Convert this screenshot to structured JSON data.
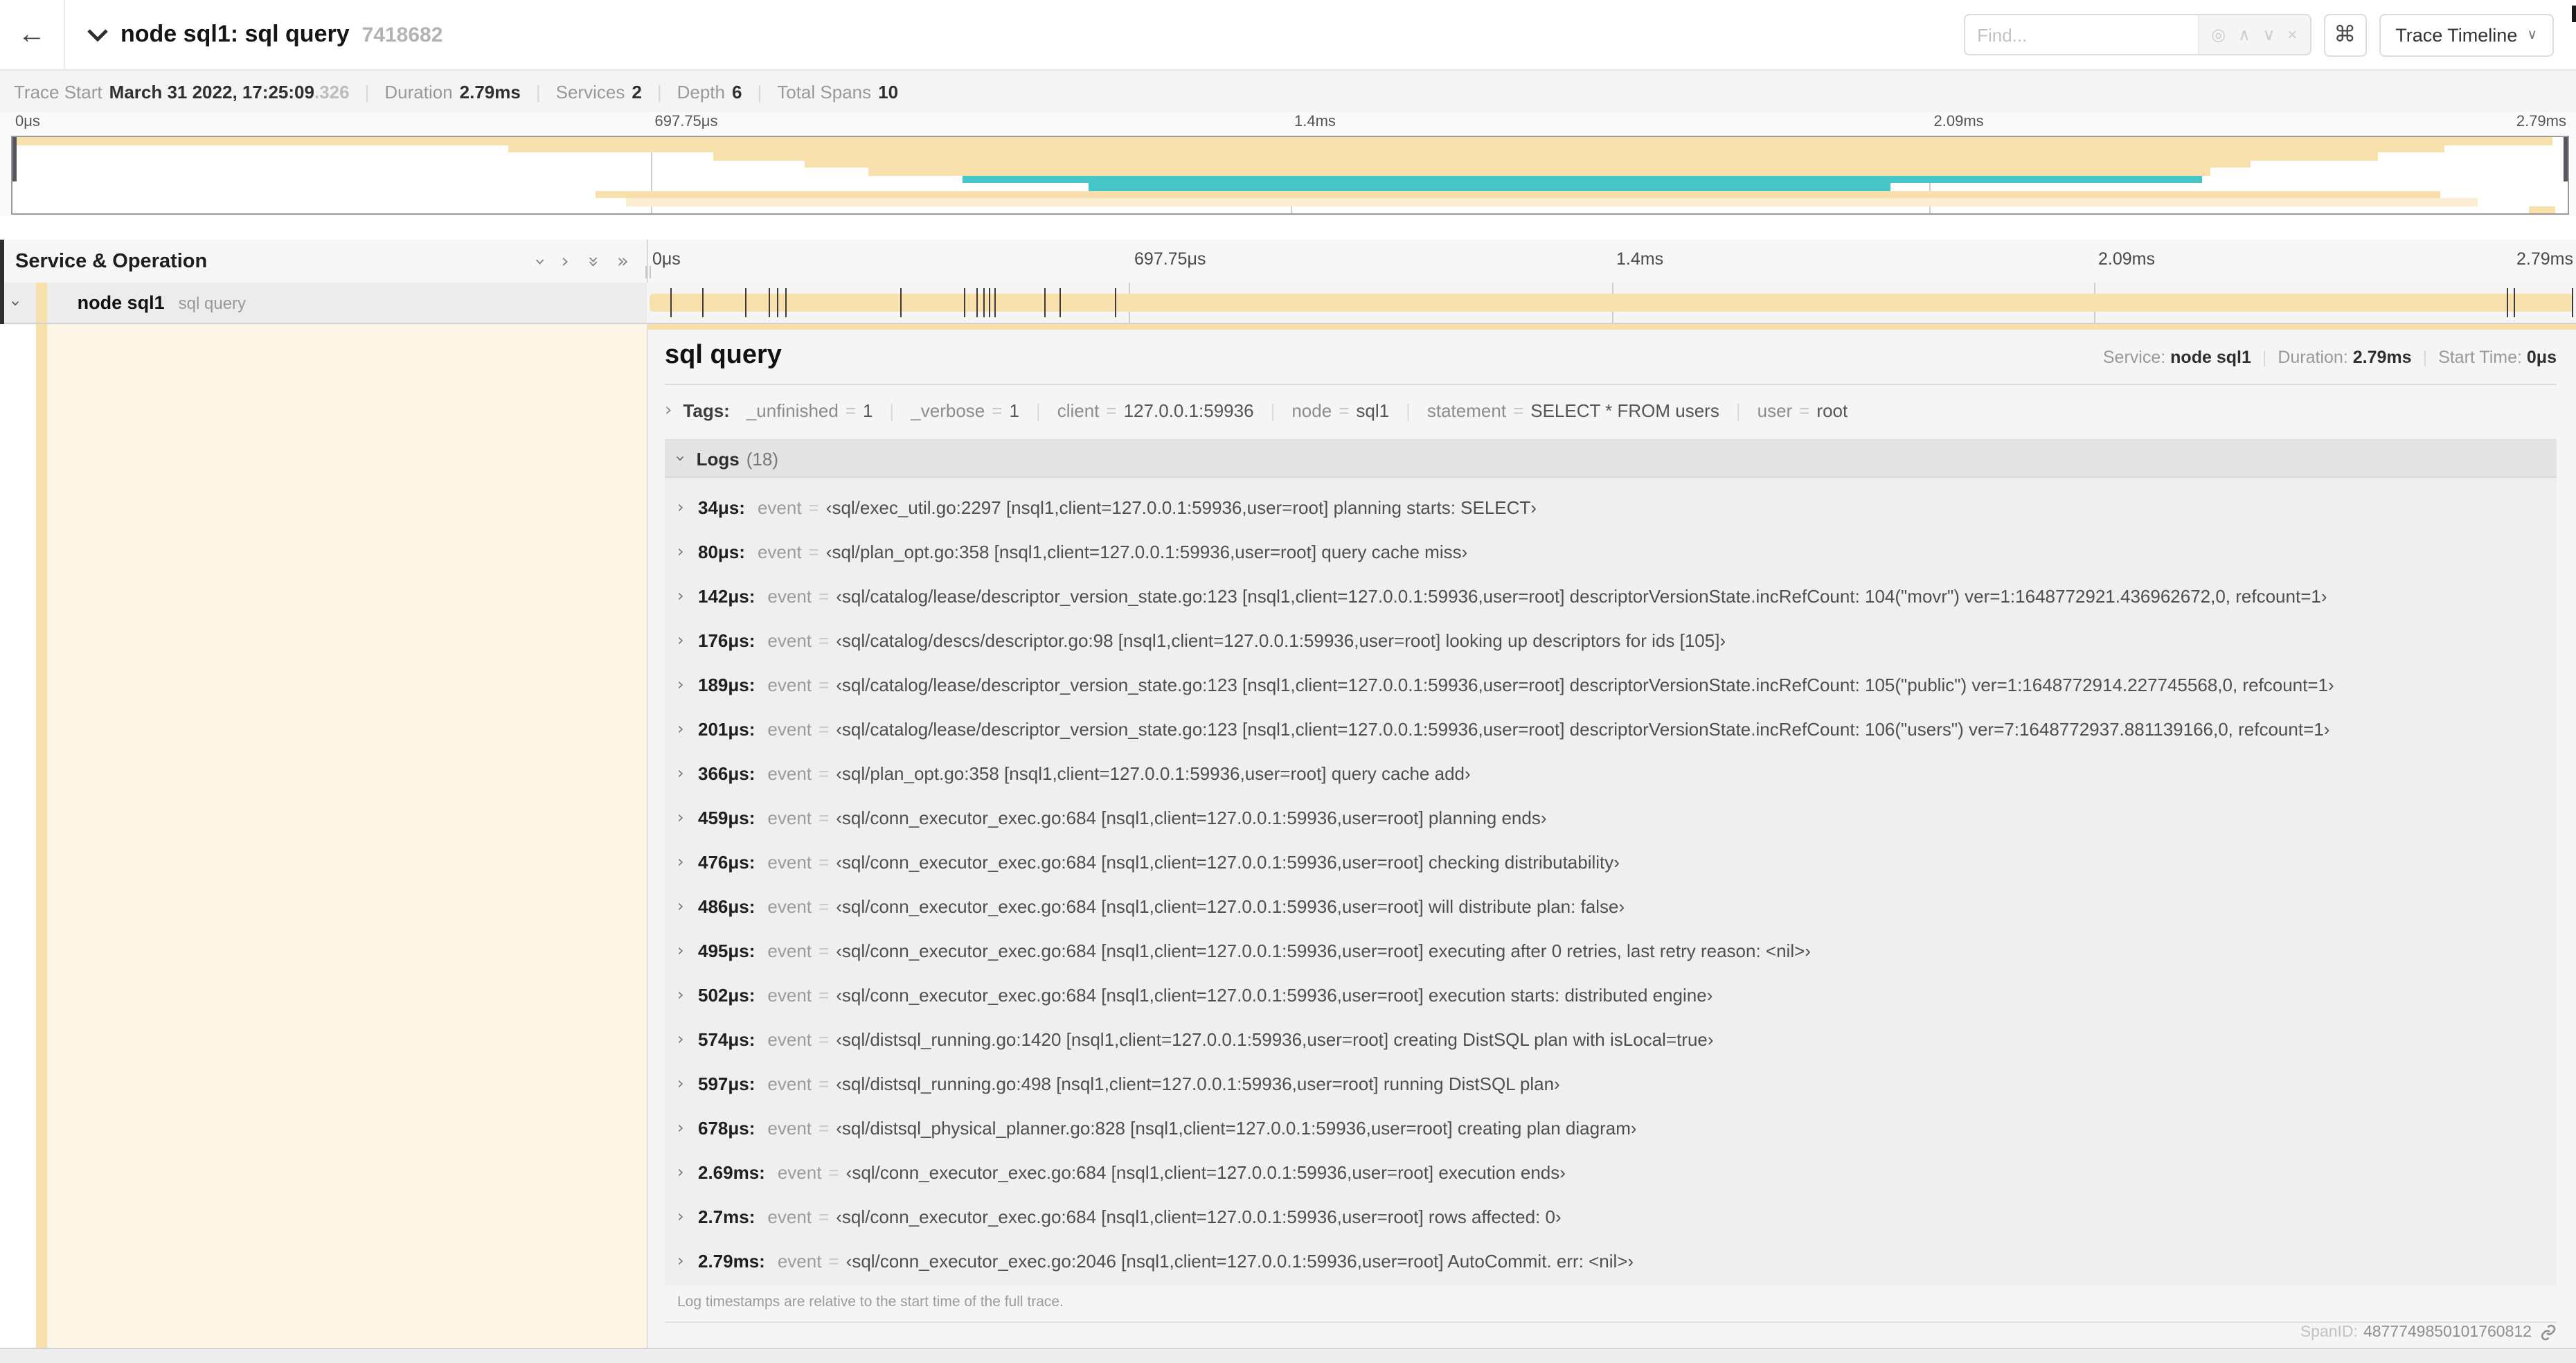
{
  "header": {
    "back_icon": "←",
    "title": "node sql1: sql query",
    "trace_id": "7418682",
    "find_placeholder": "Find...",
    "find_icons": [
      "◎",
      "∧",
      "∨",
      "×"
    ],
    "shortcut_button": "⌘",
    "view_selector": "Trace Timeline"
  },
  "trace_info": {
    "items": [
      {
        "label": "Trace Start",
        "value": "March 31 2022, 17:25:09",
        "suffix": ".326"
      },
      {
        "label": "Duration",
        "value": "2.79ms"
      },
      {
        "label": "Services",
        "value": "2"
      },
      {
        "label": "Depth",
        "value": "6"
      },
      {
        "label": "Total Spans",
        "value": "10"
      }
    ]
  },
  "minimap": {
    "ticks": [
      {
        "label": "0μs",
        "pct": 0
      },
      {
        "label": "697.75μs",
        "pct": 25
      },
      {
        "label": "1.4ms",
        "pct": 50
      },
      {
        "label": "2.09ms",
        "pct": 75
      },
      {
        "label": "2.79ms",
        "pct": 100
      }
    ],
    "bars": [
      {
        "row": 0,
        "start": 0,
        "end": 99.4,
        "color": "tan"
      },
      {
        "row": 1,
        "start": 19.4,
        "end": 95.2,
        "color": "tan"
      },
      {
        "row": 2,
        "start": 27.4,
        "end": 92.6,
        "color": "tan"
      },
      {
        "row": 3,
        "start": 31.0,
        "end": 87.6,
        "color": "tan"
      },
      {
        "row": 4,
        "start": 33.5,
        "end": 86.0,
        "color": "tan"
      },
      {
        "row": 5,
        "start": 37.2,
        "end": 85.7,
        "color": "teal"
      },
      {
        "row": 6,
        "start": 42.1,
        "end": 73.5,
        "color": "teal"
      },
      {
        "row": 7,
        "start": 22.8,
        "end": 95.0,
        "color": "tan"
      },
      {
        "row": 8,
        "start": 24.0,
        "end": 96.5,
        "color": "paletan"
      },
      {
        "row": 9,
        "start": 98.5,
        "end": 99.5,
        "color": "tan"
      }
    ]
  },
  "timeline": {
    "left_header": "Service & Operation",
    "collapse_icons": [
      "∨",
      "›",
      "⋁⋁",
      "»"
    ],
    "ticks": [
      {
        "label": "0μs",
        "pct": 0
      },
      {
        "label": "697.75μs",
        "pct": 25
      },
      {
        "label": "1.4ms",
        "pct": 50
      },
      {
        "label": "2.09ms",
        "pct": 75
      },
      {
        "label": "2.79ms",
        "pct": 100
      }
    ],
    "span": {
      "service": "node sql1",
      "operation": "sql query",
      "bar_start_pct": 0,
      "bar_end_pct": 100,
      "log_marker_pcts": [
        1.22,
        2.87,
        5.09,
        6.31,
        6.77,
        7.2,
        13.12,
        16.45,
        17.06,
        17.42,
        17.74,
        18.0,
        20.57,
        21.4,
        24.3,
        96.42,
        96.77,
        99.8
      ]
    }
  },
  "detail": {
    "title": "sql query",
    "meta": [
      {
        "label": "Service:",
        "value": "node sql1"
      },
      {
        "label": "Duration:",
        "value": "2.79ms"
      },
      {
        "label": "Start Time:",
        "value": "0μs"
      }
    ],
    "tags_label": "Tags:",
    "tags": [
      {
        "key": "_unfinished",
        "value": "1"
      },
      {
        "key": "_verbose",
        "value": "1"
      },
      {
        "key": "client",
        "value": "127.0.0.1:59936"
      },
      {
        "key": "node",
        "value": "sql1"
      },
      {
        "key": "statement",
        "value": "SELECT * FROM users"
      },
      {
        "key": "user",
        "value": "root"
      }
    ],
    "logs_label": "Logs",
    "logs_count": "(18)",
    "logs": [
      {
        "time": "34μs:",
        "key": "event",
        "value": "‹sql/exec_util.go:2297 [nsql1,client=127.0.0.1:59936,user=root] planning starts: SELECT›"
      },
      {
        "time": "80μs:",
        "key": "event",
        "value": "‹sql/plan_opt.go:358 [nsql1,client=127.0.0.1:59936,user=root] query cache miss›"
      },
      {
        "time": "142μs:",
        "key": "event",
        "value": "‹sql/catalog/lease/descriptor_version_state.go:123 [nsql1,client=127.0.0.1:59936,user=root] descriptorVersionState.incRefCount: 104(\"movr\") ver=1:1648772921.436962672,0, refcount=1›"
      },
      {
        "time": "176μs:",
        "key": "event",
        "value": "‹sql/catalog/descs/descriptor.go:98 [nsql1,client=127.0.0.1:59936,user=root] looking up descriptors for ids [105]›"
      },
      {
        "time": "189μs:",
        "key": "event",
        "value": "‹sql/catalog/lease/descriptor_version_state.go:123 [nsql1,client=127.0.0.1:59936,user=root] descriptorVersionState.incRefCount: 105(\"public\") ver=1:1648772914.227745568,0, refcount=1›"
      },
      {
        "time": "201μs:",
        "key": "event",
        "value": "‹sql/catalog/lease/descriptor_version_state.go:123 [nsql1,client=127.0.0.1:59936,user=root] descriptorVersionState.incRefCount: 106(\"users\") ver=7:1648772937.881139166,0, refcount=1›"
      },
      {
        "time": "366μs:",
        "key": "event",
        "value": "‹sql/plan_opt.go:358 [nsql1,client=127.0.0.1:59936,user=root] query cache add›"
      },
      {
        "time": "459μs:",
        "key": "event",
        "value": "‹sql/conn_executor_exec.go:684 [nsql1,client=127.0.0.1:59936,user=root] planning ends›"
      },
      {
        "time": "476μs:",
        "key": "event",
        "value": "‹sql/conn_executor_exec.go:684 [nsql1,client=127.0.0.1:59936,user=root] checking distributability›"
      },
      {
        "time": "486μs:",
        "key": "event",
        "value": "‹sql/conn_executor_exec.go:684 [nsql1,client=127.0.0.1:59936,user=root] will distribute plan: false›"
      },
      {
        "time": "495μs:",
        "key": "event",
        "value": "‹sql/conn_executor_exec.go:684 [nsql1,client=127.0.0.1:59936,user=root] executing after 0 retries, last retry reason: <nil>›"
      },
      {
        "time": "502μs:",
        "key": "event",
        "value": "‹sql/conn_executor_exec.go:684 [nsql1,client=127.0.0.1:59936,user=root] execution starts: distributed engine›"
      },
      {
        "time": "574μs:",
        "key": "event",
        "value": "‹sql/distsql_running.go:1420 [nsql1,client=127.0.0.1:59936,user=root] creating DistSQL plan with isLocal=true›"
      },
      {
        "time": "597μs:",
        "key": "event",
        "value": "‹sql/distsql_running.go:498 [nsql1,client=127.0.0.1:59936,user=root] running DistSQL plan›"
      },
      {
        "time": "678μs:",
        "key": "event",
        "value": "‹sql/distsql_physical_planner.go:828 [nsql1,client=127.0.0.1:59936,user=root] creating plan diagram›"
      },
      {
        "time": "2.69ms:",
        "key": "event",
        "value": "‹sql/conn_executor_exec.go:684 [nsql1,client=127.0.0.1:59936,user=root] execution ends›"
      },
      {
        "time": "2.7ms:",
        "key": "event",
        "value": "‹sql/conn_executor_exec.go:684 [nsql1,client=127.0.0.1:59936,user=root] rows affected: 0›"
      },
      {
        "time": "2.79ms:",
        "key": "event",
        "value": "‹sql/conn_executor_exec.go:2046 [nsql1,client=127.0.0.1:59936,user=root] AutoCommit. err: <nil>›"
      }
    ],
    "logs_note": "Log timestamps are relative to the start time of the full trace.",
    "span_id_label": "SpanID:",
    "span_id": "4877749850101760812"
  },
  "colors": {
    "tan": "#f7e0ac",
    "teal": "#45c5c5",
    "paletan": "#fbeed0",
    "cream": "#fdf6e6"
  }
}
